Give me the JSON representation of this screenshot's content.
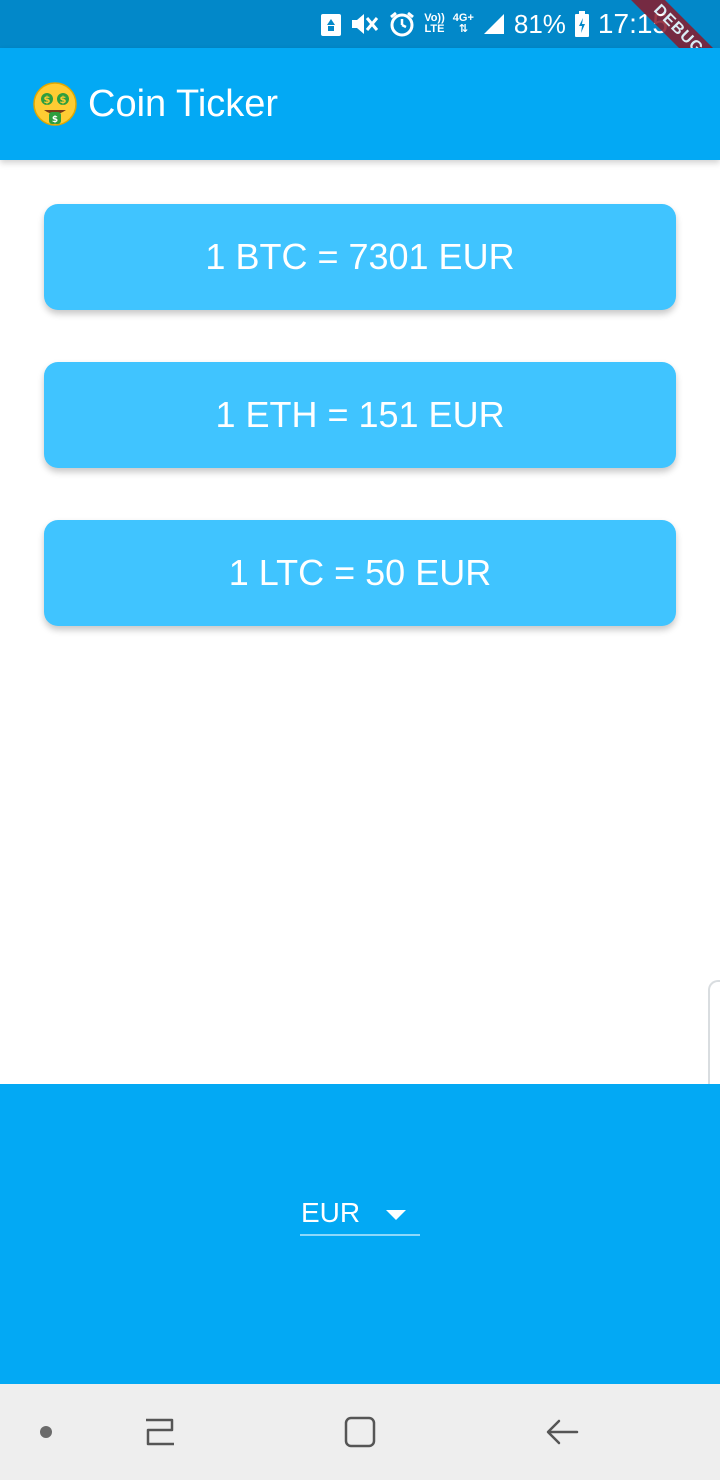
{
  "status_bar": {
    "volte_top": "Vo))",
    "volte_bottom": "LTE",
    "network_type": "4G+",
    "battery_percent": "81%",
    "time": "17:15"
  },
  "debug_banner": "DEBUG",
  "app_bar": {
    "emoji_icon": "money-mouth-face-icon",
    "title": "Coin Ticker"
  },
  "rates": [
    {
      "text": "1 BTC = 7301 EUR"
    },
    {
      "text": "1 ETH = 151 EUR"
    },
    {
      "text": "1 LTC = 50 EUR"
    }
  ],
  "currency_picker": {
    "selected": "EUR"
  },
  "nav_bar": {
    "items": [
      "dot-icon",
      "recent-apps-icon",
      "home-icon",
      "back-icon"
    ]
  },
  "colors": {
    "status_bar": "#0288c9",
    "app_bar": "#03a9f4",
    "card": "#40c4ff",
    "picker_area": "#03a9f4",
    "nav_bar": "#eeeeee"
  }
}
